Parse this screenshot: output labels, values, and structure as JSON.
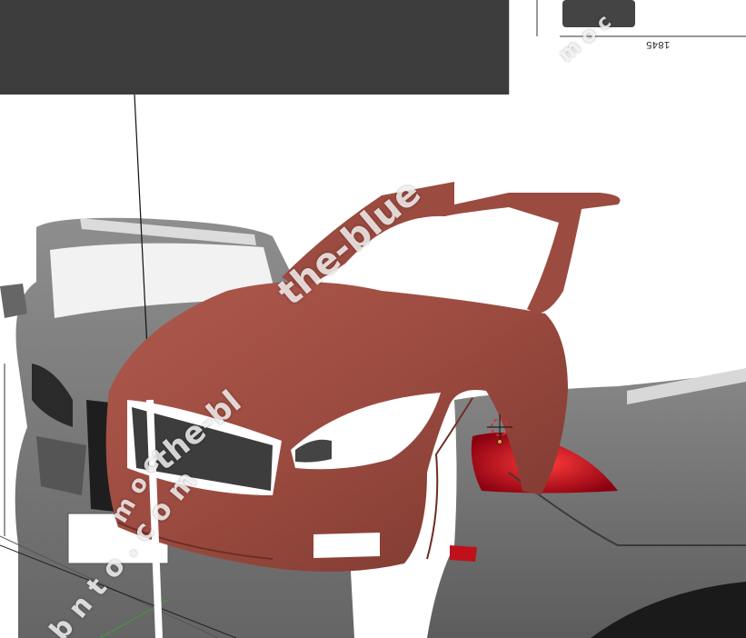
{
  "blueprint": {
    "dimension_label": "1845",
    "watermark_1": "the-blue",
    "watermark_2": "the-bl",
    "watermark_3": "m o c",
    "watermark_4": "b n t o . c o m",
    "watermark_5": "m o c"
  },
  "colors": {
    "top_panel": "#3c3c3c",
    "body_mesh": "#9a4a3f",
    "blueprint_car": "#5a5a5a",
    "tail_light": "#c0101a"
  },
  "icons": [
    "3d-cursor-icon",
    "origin-point-icon"
  ]
}
